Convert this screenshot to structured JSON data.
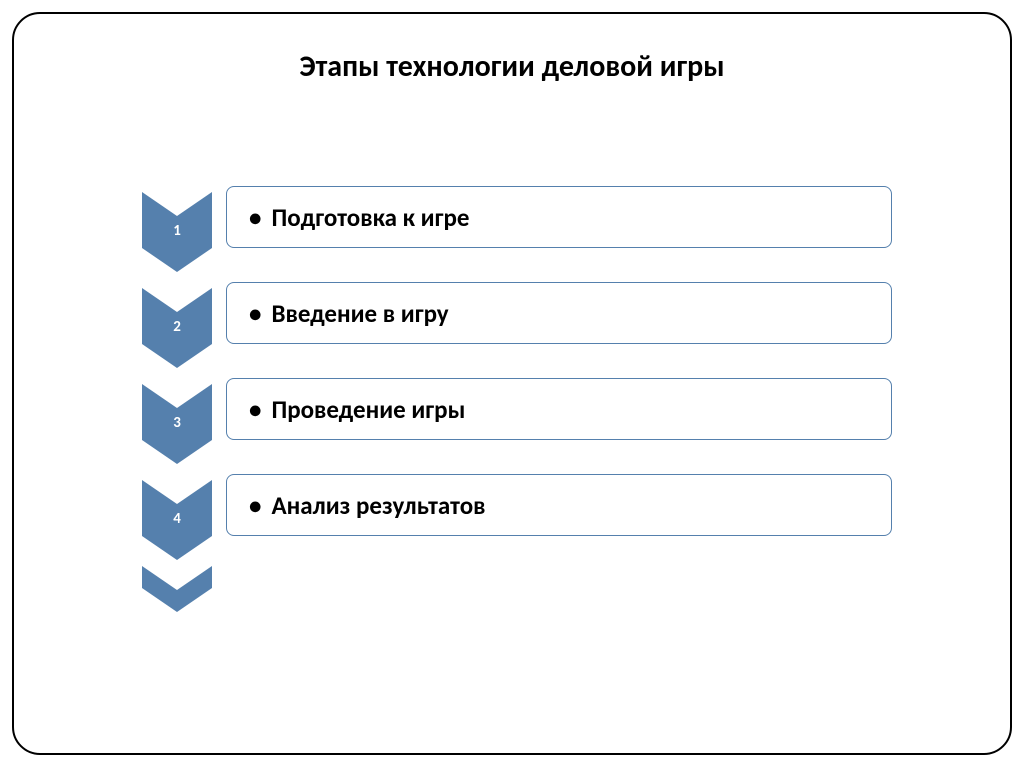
{
  "title": "Этапы технологии деловой игры",
  "accent_color": "#5580ad",
  "steps": [
    {
      "num": "1",
      "label": "Подготовка к игре"
    },
    {
      "num": "2",
      "label": "Введение в игру"
    },
    {
      "num": "3",
      "label": "Проведение игры"
    },
    {
      "num": "4",
      "label": "Анализ результатов"
    }
  ]
}
